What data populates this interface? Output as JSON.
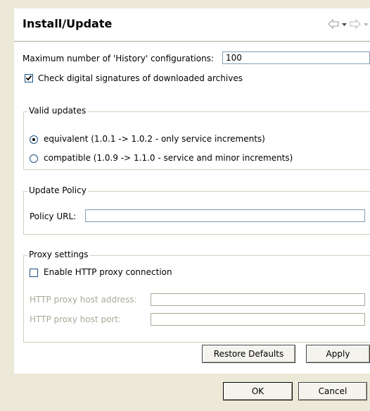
{
  "header": {
    "title": "Install/Update"
  },
  "history": {
    "label": "Maximum number of 'History' configurations:",
    "value": "100"
  },
  "signatures": {
    "label": "Check digital signatures of downloaded archives",
    "checked": true
  },
  "valid_updates": {
    "title": "Valid updates",
    "options": [
      {
        "label": "equivalent (1.0.1 -> 1.0.2 - only service increments)",
        "selected": true
      },
      {
        "label": "compatible (1.0.9 -> 1.1.0 - service and minor increments)",
        "selected": false
      }
    ]
  },
  "update_policy": {
    "title": "Update Policy",
    "url_label": "Policy URL:",
    "url_value": ""
  },
  "proxy": {
    "title": "Proxy settings",
    "enable_label": "Enable HTTP proxy connection",
    "enabled": false,
    "host_label": "HTTP proxy host address:",
    "host_value": "",
    "port_label": "HTTP proxy host port:",
    "port_value": ""
  },
  "buttons": {
    "restore_defaults": "Restore Defaults",
    "apply": "Apply",
    "ok": "OK",
    "cancel": "Cancel"
  }
}
